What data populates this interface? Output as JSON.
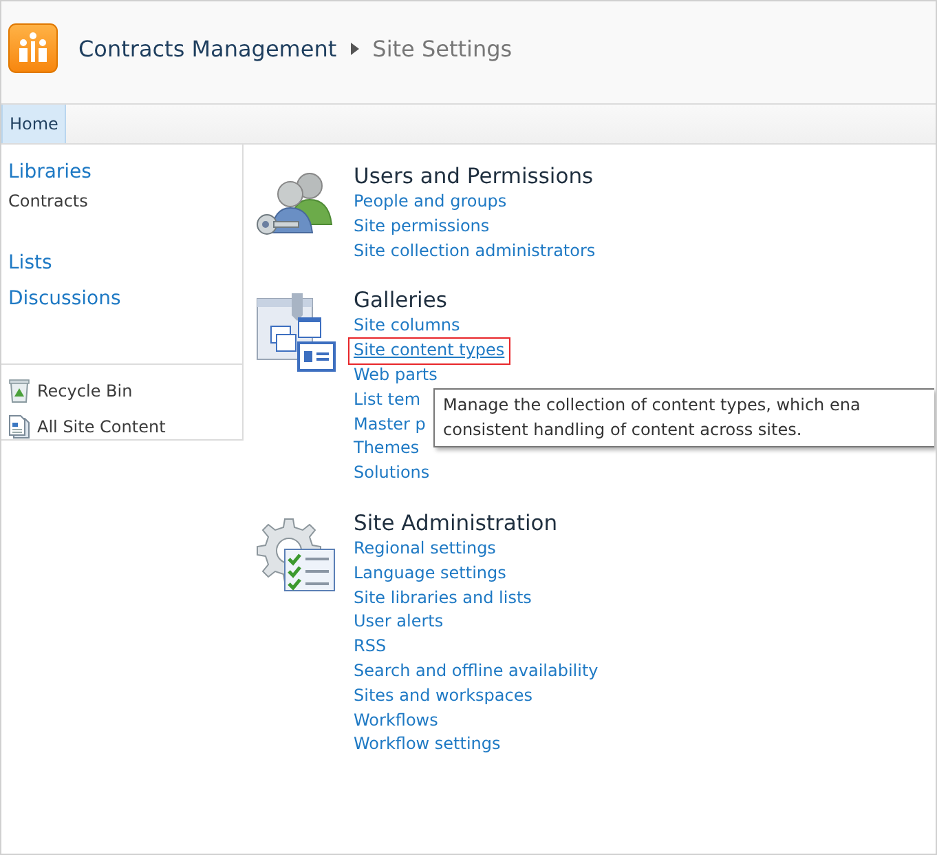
{
  "header": {
    "site_title": "Contracts Management",
    "page_title": "Site Settings"
  },
  "top_nav": [
    {
      "label": "Home",
      "selected": true
    }
  ],
  "quick_launch": {
    "groups": [
      {
        "heading": "Libraries",
        "items": [
          "Contracts"
        ]
      },
      {
        "heading": "Lists"
      },
      {
        "heading": "Discussions"
      }
    ],
    "footer_items": [
      {
        "kind": "recycle-bin",
        "label": "Recycle Bin"
      },
      {
        "kind": "all-content",
        "label": "All Site Content"
      }
    ]
  },
  "sections": [
    {
      "kind": "users",
      "title": "Users and Permissions",
      "links": [
        {
          "label": "People and groups",
          "highlighted": false
        },
        {
          "label": "Site permissions",
          "highlighted": false
        },
        {
          "label": "Site collection administrators",
          "highlighted": false
        }
      ]
    },
    {
      "kind": "galleries",
      "title": "Galleries",
      "links": [
        {
          "label": "Site columns",
          "highlighted": false
        },
        {
          "label": "Site content types",
          "highlighted": true
        },
        {
          "label": "Web parts",
          "highlighted": false
        },
        {
          "label": "List tem",
          "highlighted": false
        },
        {
          "label": "Master p",
          "highlighted": false
        },
        {
          "label": "Themes",
          "highlighted": false
        },
        {
          "label": "Solutions",
          "highlighted": false
        }
      ],
      "tooltip": {
        "lines": [
          "Manage the collection of content types, which ena",
          "consistent handling of content across sites."
        ]
      }
    },
    {
      "kind": "admin",
      "title": "Site Administration",
      "links": [
        {
          "label": "Regional settings",
          "highlighted": false
        },
        {
          "label": "Language settings",
          "highlighted": false
        },
        {
          "label": "Site libraries and lists",
          "highlighted": false
        },
        {
          "label": "User alerts",
          "highlighted": false
        },
        {
          "label": "RSS",
          "highlighted": false
        },
        {
          "label": "Search and offline availability",
          "highlighted": false
        },
        {
          "label": "Sites and workspaces",
          "highlighted": false
        },
        {
          "label": "Workflows",
          "highlighted": false
        },
        {
          "label": "Workflow settings",
          "highlighted": false
        }
      ]
    }
  ]
}
